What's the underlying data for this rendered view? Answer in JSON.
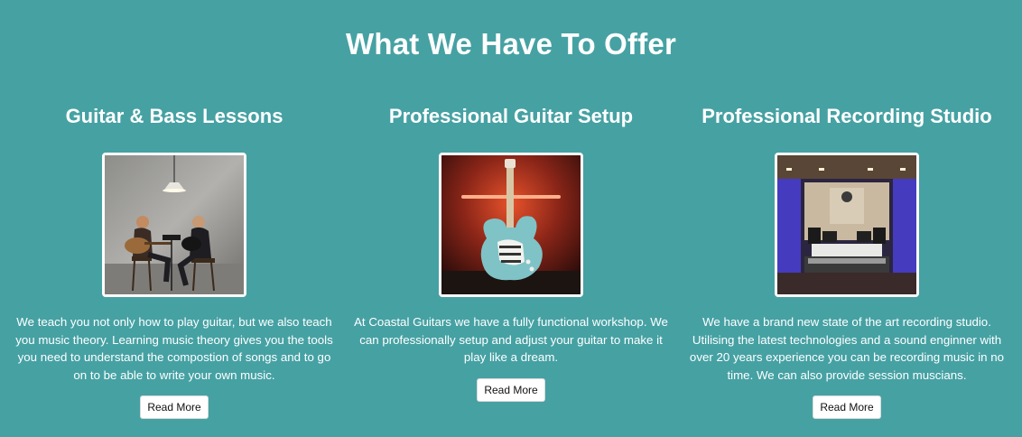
{
  "section": {
    "title": "What We Have To Offer"
  },
  "cards": [
    {
      "title": "Guitar & Bass Lessons",
      "description": "We teach you not only how to play guitar, but we also teach you music theory. Learning music theory gives you the tools you need to understand the compostion of songs and to go on to be able to write your own music.",
      "button": "Read More",
      "image": "guitar-lesson-photo"
    },
    {
      "title": "Professional Guitar Setup",
      "description": "At Coastal Guitars we have a fully functional workshop. We can professionally setup and adjust your guitar to make it play like a dream.",
      "button": "Read More",
      "image": "electric-guitar-photo"
    },
    {
      "title": "Professional Recording Studio",
      "description": "We have a brand new state of the art recording studio. Utilising the latest technologies and a sound enginner with over 20 years experience you can be recording music in no time. We can also provide session muscians.",
      "button": "Read More",
      "image": "recording-studio-photo"
    }
  ],
  "colors": {
    "background": "#46a1a3",
    "text": "#ffffff",
    "button_bg": "#ffffff"
  }
}
